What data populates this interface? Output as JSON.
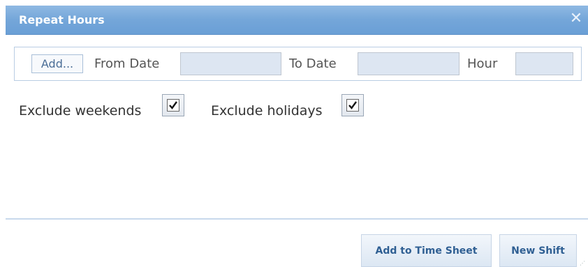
{
  "dialog": {
    "title": "Repeat Hours",
    "close_icon": "close-icon"
  },
  "date_row": {
    "add_label": "Add...",
    "from_label": "From Date",
    "from_value": "",
    "to_label": "To Date",
    "to_value": "",
    "hour_label": "Hour",
    "hour_value": ""
  },
  "options": {
    "exclude_weekends_label": "Exclude weekends",
    "exclude_weekends_checked": true,
    "exclude_holidays_label": "Exclude holidays",
    "exclude_holidays_checked": true
  },
  "footer": {
    "add_to_time_sheet_label": "Add to Time Sheet",
    "new_shift_label": "New Shift"
  },
  "colors": {
    "titlebar": "#74a6d9",
    "field_bg": "#dde6f2",
    "button_text": "#2f5f93"
  }
}
